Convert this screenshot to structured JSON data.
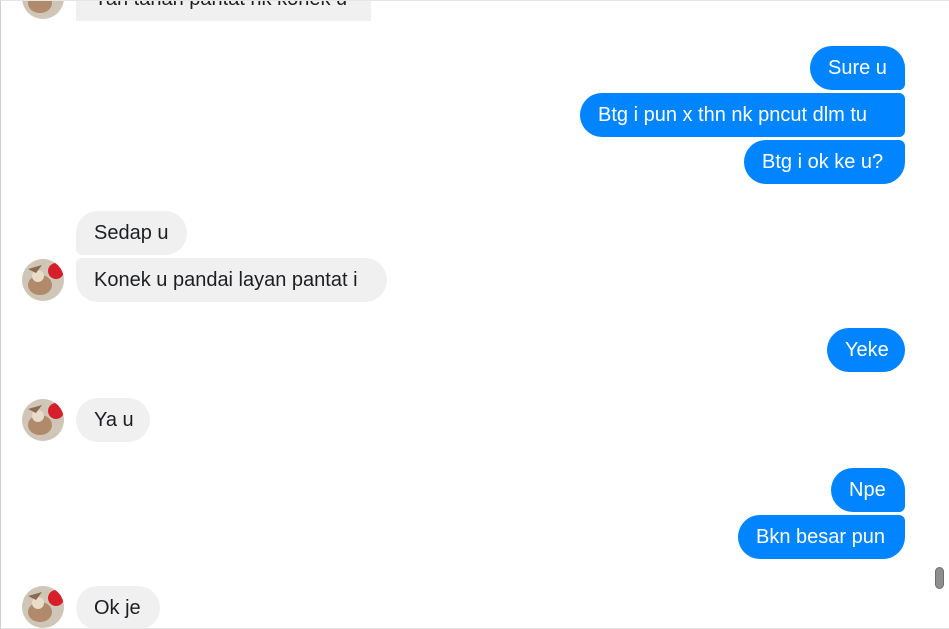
{
  "conversation": {
    "messages": [
      {
        "from": "contact",
        "text": "Yan tahan pantat nk konek u"
      },
      {
        "from": "me",
        "text": "Sure u"
      },
      {
        "from": "me",
        "text": "Btg i pun x thn nk pncut dlm tu"
      },
      {
        "from": "me",
        "text": "Btg i ok ke u?"
      },
      {
        "from": "contact",
        "text": "Sedap u"
      },
      {
        "from": "contact",
        "text": "Konek u pandai layan pantat i"
      },
      {
        "from": "me",
        "text": "Yeke"
      },
      {
        "from": "contact",
        "text": "Ya u"
      },
      {
        "from": "me",
        "text": "Npe"
      },
      {
        "from": "me",
        "text": "Bkn besar pun"
      },
      {
        "from": "contact",
        "text": "Ok je"
      }
    ]
  },
  "colors": {
    "outgoing_bubble": "#0084ff",
    "incoming_bubble": "#f0f0f0",
    "outgoing_text": "#ffffff",
    "incoming_text": "#1c1e21"
  }
}
